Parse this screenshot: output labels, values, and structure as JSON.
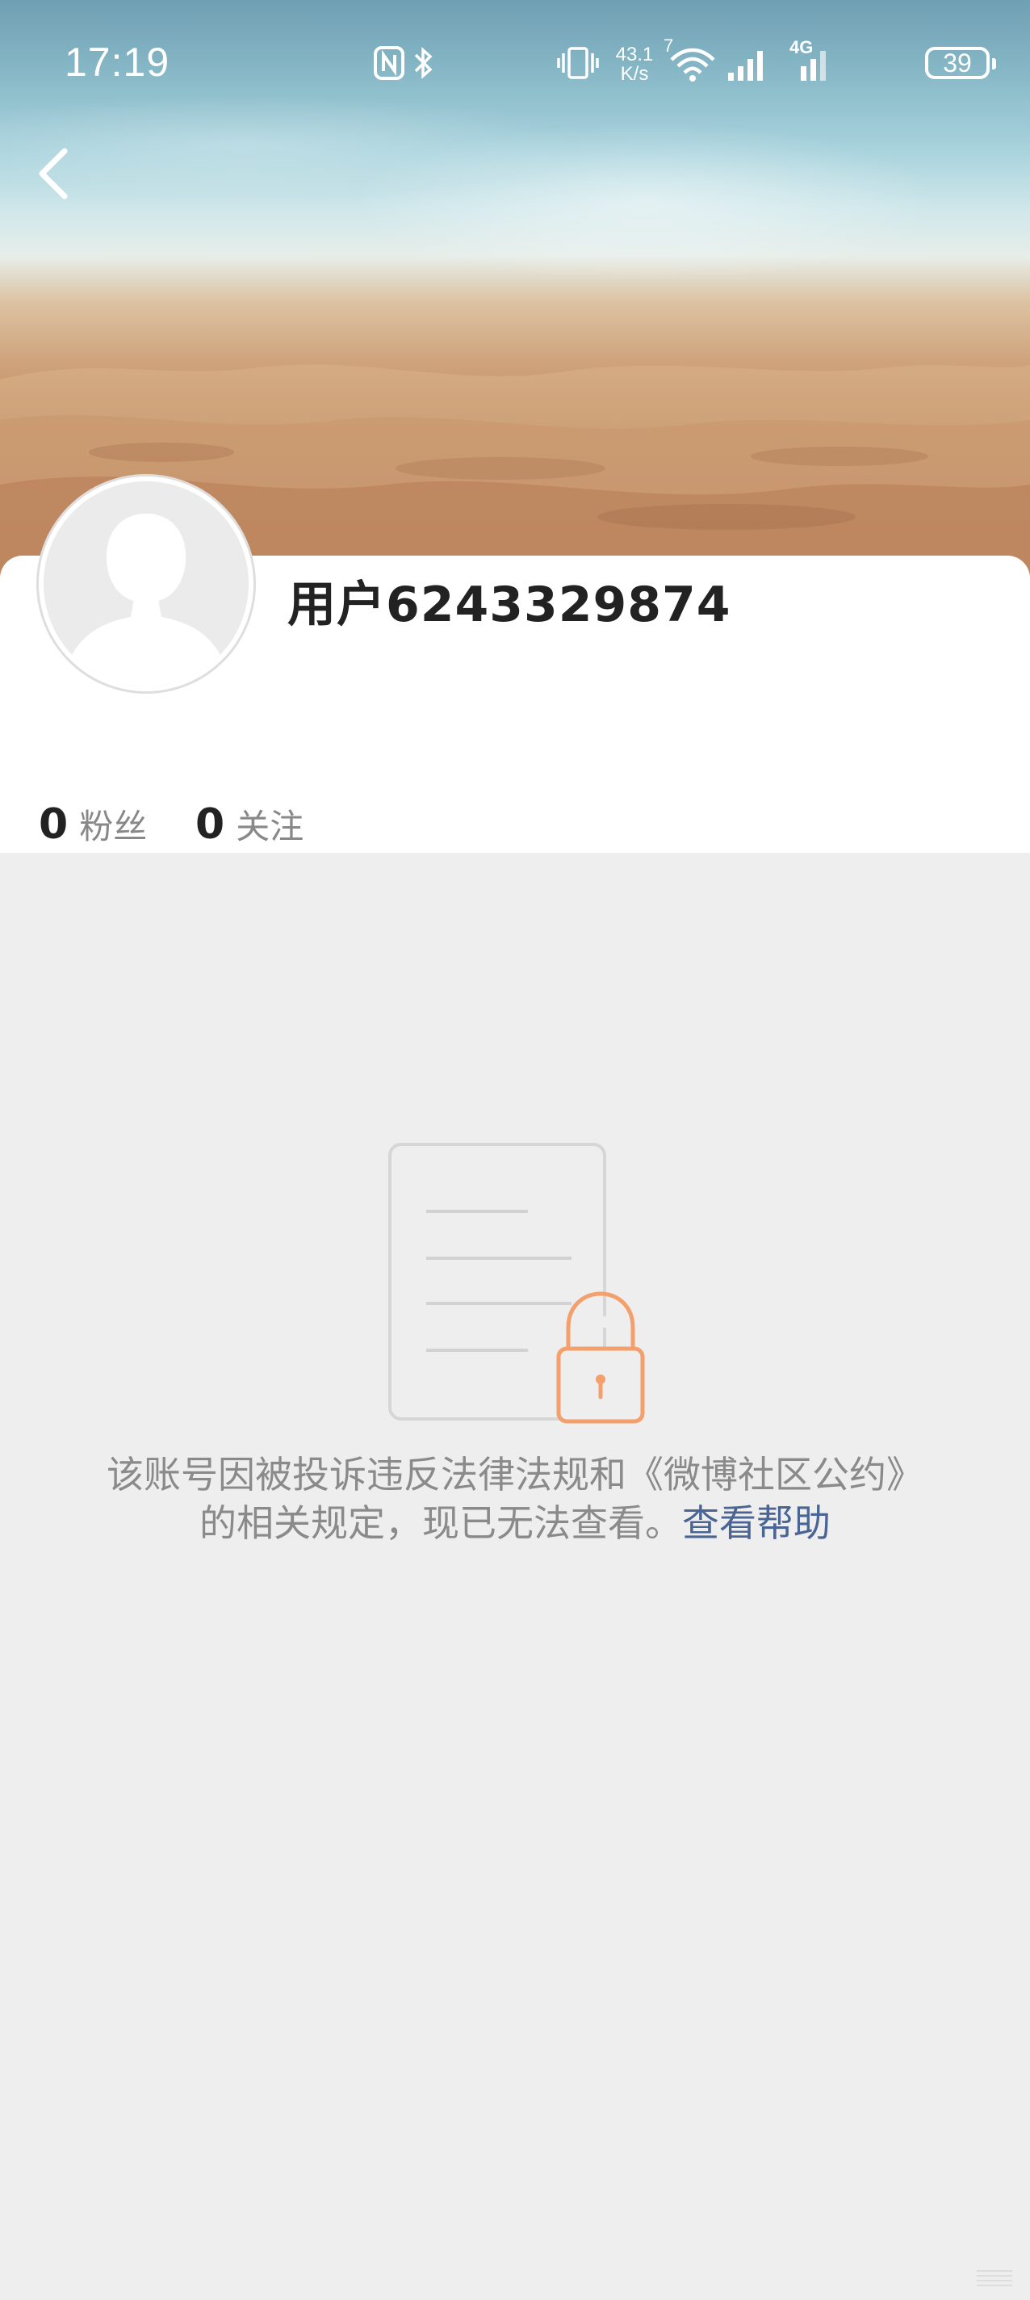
{
  "status_bar": {
    "time": "17:19",
    "network_speed_value": "43.1",
    "network_speed_unit": "K/s",
    "wifi_badge": "7",
    "cellular_label": "4G",
    "battery_level": "39"
  },
  "profile": {
    "username": "用户6243329874",
    "followers_count": "0",
    "followers_label": "粉丝",
    "following_count": "0",
    "following_label": "关注"
  },
  "notice": {
    "message": "该账号因被投诉违反法律法规和《微博社区公约》的相关规定，现已无法查看。",
    "help_link": "查看帮助"
  },
  "colors": {
    "link": "#4a6594",
    "lock_accent": "#f3a06c",
    "background": "#eeeeee"
  },
  "icons": [
    "back-arrow-icon",
    "nfc-icon",
    "bluetooth-icon",
    "vibrate-icon",
    "wifi-icon",
    "signal-icon",
    "signal-4g-icon",
    "battery-icon",
    "avatar-placeholder-icon",
    "document-lock-icon"
  ]
}
